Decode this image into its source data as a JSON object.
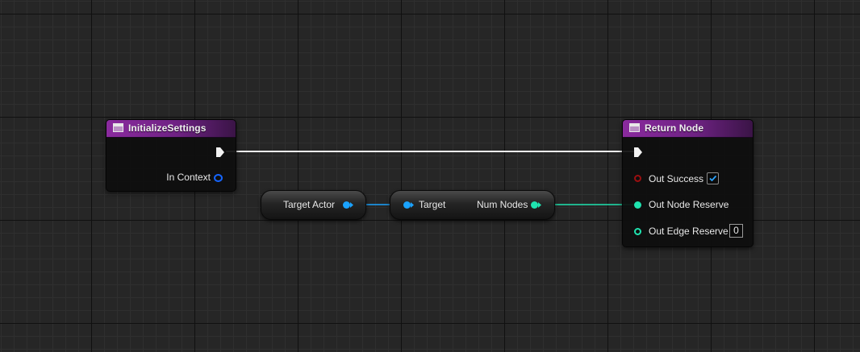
{
  "nodes": {
    "initialize_settings": {
      "title": "InitializeSettings",
      "pins": {
        "in_context": "In Context"
      }
    },
    "target_actor": {
      "label": "Target Actor"
    },
    "num_nodes": {
      "target_label": "Target",
      "output_label": "Num Nodes"
    },
    "return_node": {
      "title": "Return Node",
      "pins": {
        "out_success": "Out Success",
        "out_node_reserve": "Out Node Reserve",
        "out_edge_reserve": "Out Edge Reserve"
      },
      "out_success_value": true,
      "out_edge_reserve_value": "0"
    }
  },
  "icons": {
    "function": "function-icon",
    "exec": "exec-arrow-icon",
    "checkmark": "checkmark-icon"
  },
  "colors": {
    "background": "#262626",
    "grid_minor": "#2f2f2f",
    "grid_major": "#101010",
    "header_purple": "#8a2a9e",
    "object_pin": "#1aa3ff",
    "interface_pin": "#1565ff",
    "integer_pin": "#1fe3af",
    "bool_pin": "#9b0f10",
    "exec_wire": "#f0f0f0"
  }
}
